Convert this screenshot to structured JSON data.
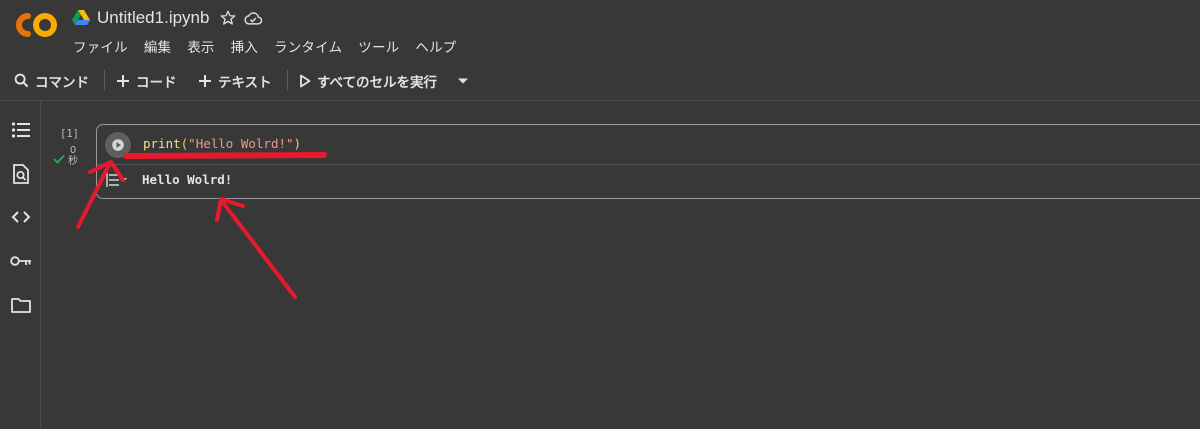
{
  "app": {
    "logo_text": "CO",
    "notebook_title": "Untitled1.ipynb"
  },
  "menu": [
    "ファイル",
    "編集",
    "表示",
    "挿入",
    "ランタイム",
    "ツール",
    "ヘルプ"
  ],
  "toolbar": {
    "commands_label": "コマンド",
    "add_code_label": "コード",
    "add_text_label": "テキスト",
    "run_all_label": "すべてのセルを実行"
  },
  "sidebar": {
    "icons": [
      "toc-icon",
      "find-icon",
      "code-snippets-icon",
      "secrets-key-icon",
      "files-folder-icon"
    ]
  },
  "cell": {
    "execution_count": "[1]",
    "exec_time_value": "0",
    "exec_time_unit": "秒",
    "code": {
      "fn": "print",
      "open_paren": "(",
      "string": "\"Hello Wolrd!\"",
      "close_paren": ")"
    },
    "output": "Hello Wolrd!"
  },
  "colors": {
    "background": "#383838",
    "annotation_red": "#e8192c",
    "success_check": "#34a853",
    "logo_orange": "#f9ab00",
    "logo_orange_dark": "#e8710a"
  }
}
